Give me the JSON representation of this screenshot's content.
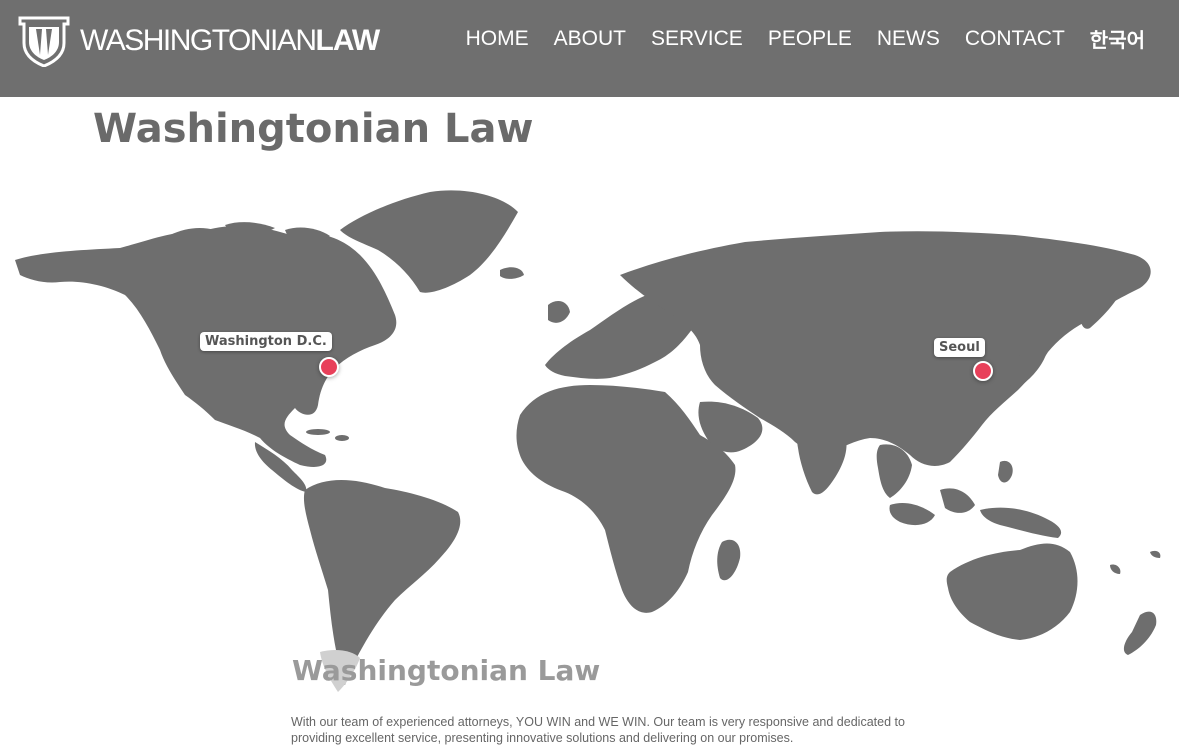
{
  "header": {
    "logo_light": "WASHINGTONIAN",
    "logo_bold": "LAW"
  },
  "nav": {
    "items": [
      {
        "label": "HOME"
      },
      {
        "label": "ABOUT"
      },
      {
        "label": "SERVICE"
      },
      {
        "label": "PEOPLE"
      },
      {
        "label": "NEWS"
      },
      {
        "label": "CONTACT"
      },
      {
        "label": "한국어"
      }
    ]
  },
  "main": {
    "title": "Washingtonian Law",
    "map": {
      "markers": [
        {
          "label": "Washington D.C."
        },
        {
          "label": "Seoul"
        }
      ]
    },
    "subtitle": "Washingtonian Law",
    "description": "With our team of experienced attorneys, YOU WIN and WE WIN. Our team is very responsive and dedicated to providing excellent service, presenting innovative solutions and delivering on our promises."
  },
  "colors": {
    "header_bg": "#6f6f6f",
    "map_land": "#6e6e6e",
    "marker": "#e8405a",
    "title": "#6a6a6a"
  }
}
